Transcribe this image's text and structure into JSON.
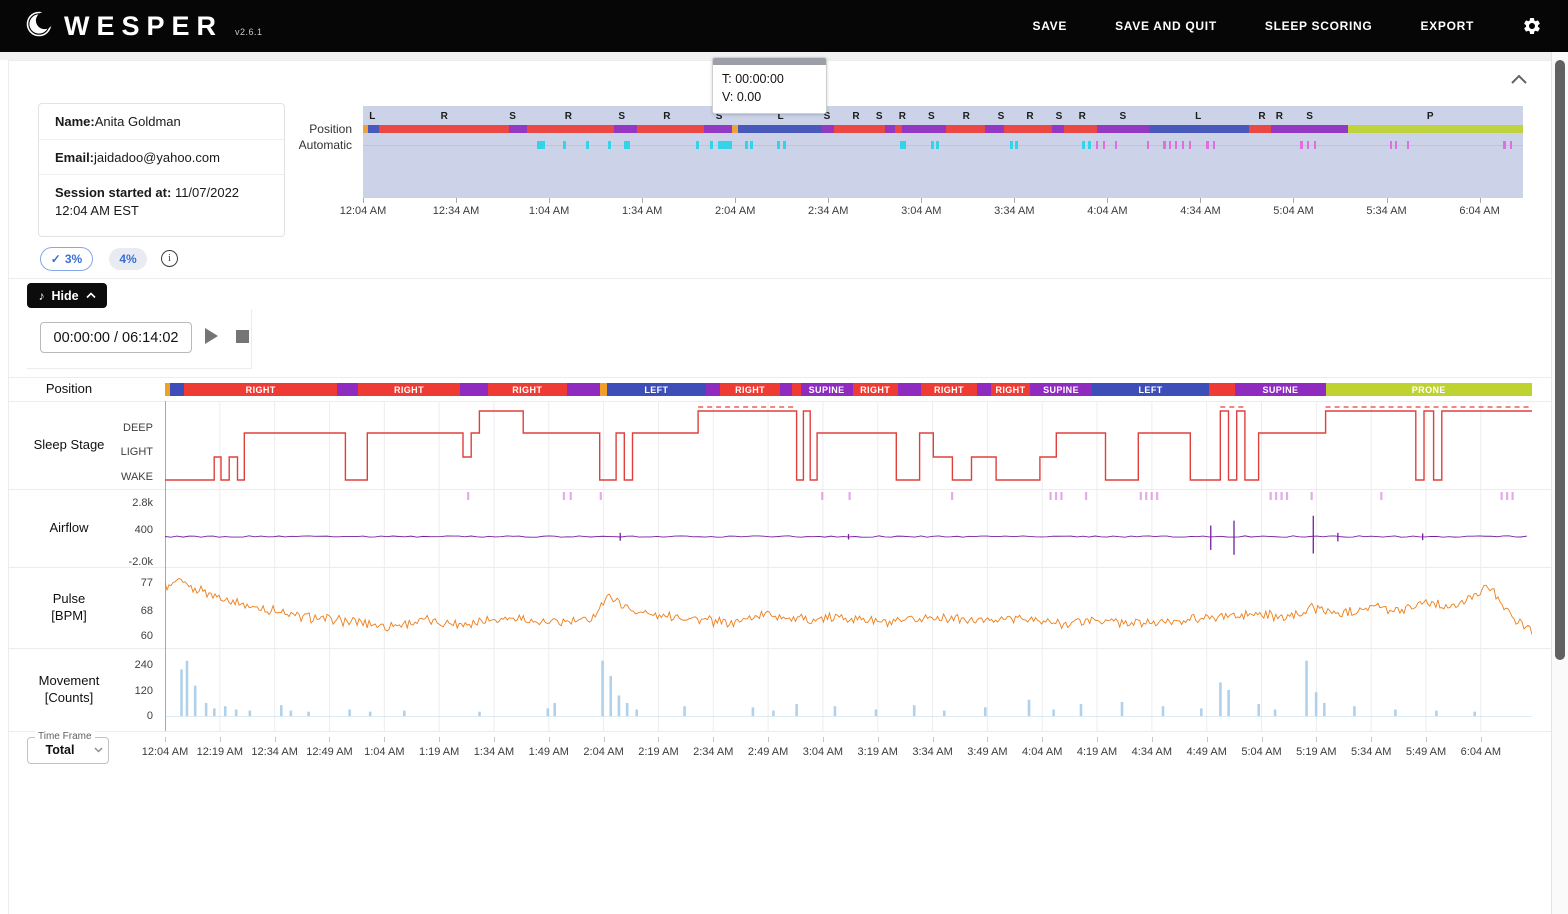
{
  "app": {
    "name": "WESPER",
    "version": "v2.6.1"
  },
  "navbar": {
    "items": [
      {
        "label": "SAVE"
      },
      {
        "label": "SAVE AND QUIT"
      },
      {
        "label": "SLEEP SCORING"
      },
      {
        "label": "EXPORT"
      }
    ],
    "settings_icon": "gear-icon"
  },
  "patient": {
    "name_label": "Name:",
    "name": "Anita Goldman",
    "email_label": "Email:",
    "email": "jaidadoo@yahoo.com",
    "session_label": "Session started at:",
    "session": " 11/07/2022 12:04 AM EST"
  },
  "tooltip": {
    "time_line": "T: 00:00:00",
    "value_line": "V: 0.00"
  },
  "overview_labels": {
    "position": "Position",
    "automatic": "Automatic"
  },
  "badges": {
    "primary": "3%",
    "primary_check": "✓",
    "secondary": "4%",
    "info_icon": "i"
  },
  "player": {
    "hide_label": "Hide",
    "note_icon": "♪",
    "time": "00:00:00 / 06:14:02"
  },
  "labels": {
    "position": "Position",
    "sleep_stage": "Sleep Stage",
    "airflow": "Airflow",
    "pulse": "Pulse\n[BPM]",
    "movement": "Movement\n[Counts]"
  },
  "timeframe": {
    "label": "Time Frame",
    "value": "Total"
  },
  "colors": {
    "red": "#ee3c35",
    "purple": "#8f2bbf",
    "blue": "#3d4eb8",
    "green": "#bed331",
    "orange": "#f0a028",
    "sleep": "#e0403c",
    "airflow": "#731fa0",
    "pulse": "#ee7d18",
    "movement": "#a9cce9",
    "cyan": "#35d3e8",
    "pink": "#e06ee0",
    "event": "#d98fe0",
    "overview_bg": "#ccd3e9",
    "accent_blue": "#3b6fd6"
  },
  "chart_data": {
    "duration_label": "06:14:02",
    "total_minutes": 374,
    "x_axis": {
      "step_minutes": 15,
      "ticks": [
        "12:04 AM",
        "12:19 AM",
        "12:34 AM",
        "12:49 AM",
        "1:04 AM",
        "1:19 AM",
        "1:34 AM",
        "1:49 AM",
        "2:04 AM",
        "2:19 AM",
        "2:34 AM",
        "2:49 AM",
        "3:04 AM",
        "3:19 AM",
        "3:34 AM",
        "3:49 AM",
        "4:04 AM",
        "4:19 AM",
        "4:34 AM",
        "4:49 AM",
        "5:04 AM",
        "5:19 AM",
        "5:34 AM",
        "5:49 AM",
        "6:04 AM"
      ]
    },
    "overview": {
      "type": "timeline",
      "step_minutes": 30,
      "ticks": [
        "12:04 AM",
        "12:34 AM",
        "1:04 AM",
        "1:34 AM",
        "2:04 AM",
        "2:34 AM",
        "3:04 AM",
        "3:34 AM",
        "4:04 AM",
        "4:34 AM",
        "5:04 AM",
        "5:34 AM",
        "6:04 AM"
      ],
      "letters": [
        [
          0.008,
          "L"
        ],
        [
          0.07,
          "R"
        ],
        [
          0.129,
          "S"
        ],
        [
          0.177,
          "R"
        ],
        [
          0.223,
          "S"
        ],
        [
          0.262,
          "R"
        ],
        [
          0.307,
          "S"
        ],
        [
          0.36,
          "L"
        ],
        [
          0.4,
          "S"
        ],
        [
          0.425,
          "R"
        ],
        [
          0.445,
          "S"
        ],
        [
          0.465,
          "R"
        ],
        [
          0.49,
          "S"
        ],
        [
          0.52,
          "R"
        ],
        [
          0.55,
          "S"
        ],
        [
          0.575,
          "R"
        ],
        [
          0.6,
          "S"
        ],
        [
          0.62,
          "R"
        ],
        [
          0.655,
          "S"
        ],
        [
          0.72,
          "L"
        ],
        [
          0.775,
          "R"
        ],
        [
          0.79,
          "R"
        ],
        [
          0.816,
          "S"
        ],
        [
          0.92,
          "P"
        ]
      ],
      "auto_marks": [
        [
          0.15,
          8,
          "cyan"
        ],
        [
          0.172,
          3,
          "cyan"
        ],
        [
          0.192,
          3,
          "cyan"
        ],
        [
          0.211,
          3,
          "cyan"
        ],
        [
          0.225,
          6,
          "cyan"
        ],
        [
          0.287,
          3,
          "cyan"
        ],
        [
          0.299,
          3,
          "cyan"
        ],
        [
          0.306,
          14,
          "cyan"
        ],
        [
          0.329,
          3,
          "cyan"
        ],
        [
          0.334,
          3,
          "cyan"
        ],
        [
          0.357,
          3,
          "cyan"
        ],
        [
          0.362,
          3,
          "cyan"
        ],
        [
          0.463,
          6,
          "cyan"
        ],
        [
          0.49,
          3,
          "cyan"
        ],
        [
          0.494,
          3,
          "cyan"
        ],
        [
          0.558,
          3,
          "cyan"
        ],
        [
          0.562,
          3,
          "cyan"
        ],
        [
          0.62,
          3,
          "cyan"
        ],
        [
          0.625,
          3,
          "cyan"
        ],
        [
          0.632,
          2,
          "pink"
        ],
        [
          0.638,
          2,
          "pink"
        ],
        [
          0.648,
          2,
          "pink"
        ],
        [
          0.676,
          2,
          "pink"
        ],
        [
          0.69,
          3,
          "pink"
        ],
        [
          0.695,
          2,
          "pink"
        ],
        [
          0.7,
          2,
          "pink"
        ],
        [
          0.706,
          2,
          "pink"
        ],
        [
          0.712,
          2,
          "pink"
        ],
        [
          0.727,
          3,
          "pink"
        ],
        [
          0.733,
          2,
          "pink"
        ],
        [
          0.808,
          3,
          "pink"
        ],
        [
          0.814,
          2,
          "pink"
        ],
        [
          0.82,
          2,
          "pink"
        ],
        [
          0.885,
          2,
          "pink"
        ],
        [
          0.89,
          2,
          "pink"
        ],
        [
          0.9,
          2,
          "pink"
        ],
        [
          0.983,
          3,
          "pink"
        ],
        [
          0.989,
          2,
          "pink"
        ]
      ]
    },
    "position": {
      "type": "timeline",
      "segments": [
        [
          0.0,
          0.004,
          "orange",
          ""
        ],
        [
          0.004,
          0.014,
          "blue",
          ""
        ],
        [
          0.014,
          0.126,
          "red",
          "RIGHT"
        ],
        [
          0.126,
          0.141,
          "purple",
          ""
        ],
        [
          0.141,
          0.216,
          "red",
          "RIGHT"
        ],
        [
          0.216,
          0.236,
          "purple",
          ""
        ],
        [
          0.236,
          0.294,
          "red",
          "RIGHT"
        ],
        [
          0.294,
          0.318,
          "purple",
          ""
        ],
        [
          0.318,
          0.323,
          "orange",
          ""
        ],
        [
          0.323,
          0.396,
          "blue",
          "LEFT"
        ],
        [
          0.396,
          0.406,
          "purple",
          ""
        ],
        [
          0.406,
          0.45,
          "red",
          "RIGHT"
        ],
        [
          0.45,
          0.459,
          "purple",
          ""
        ],
        [
          0.459,
          0.465,
          "red",
          ""
        ],
        [
          0.465,
          0.503,
          "purple",
          "SUPINE"
        ],
        [
          0.503,
          0.536,
          "red",
          "RIGHT"
        ],
        [
          0.536,
          0.553,
          "purple",
          ""
        ],
        [
          0.553,
          0.594,
          "red",
          "RIGHT"
        ],
        [
          0.594,
          0.604,
          "purple",
          ""
        ],
        [
          0.604,
          0.633,
          "red",
          "RIGHT"
        ],
        [
          0.633,
          0.678,
          "purple",
          "SUPINE"
        ],
        [
          0.678,
          0.764,
          "blue",
          "LEFT"
        ],
        [
          0.764,
          0.783,
          "red",
          ""
        ],
        [
          0.783,
          0.849,
          "purple",
          "SUPINE"
        ],
        [
          0.849,
          1.0,
          "green",
          "PRONE"
        ]
      ]
    },
    "sleep_stage": {
      "type": "step-line",
      "levels": [
        "DEEP",
        "LIGHT",
        "WAKE"
      ],
      "steps": [
        [
          0,
          "W"
        ],
        [
          0.036,
          "L"
        ],
        [
          0.041,
          "W"
        ],
        [
          0.047,
          "L"
        ],
        [
          0.053,
          "W"
        ],
        [
          0.058,
          "D"
        ],
        [
          0.132,
          "W"
        ],
        [
          0.148,
          "D"
        ],
        [
          0.218,
          "L"
        ],
        [
          0.224,
          "D"
        ],
        [
          0.23,
          "R"
        ],
        [
          0.262,
          "D"
        ],
        [
          0.318,
          "W"
        ],
        [
          0.33,
          "D"
        ],
        [
          0.336,
          "W"
        ],
        [
          0.342,
          "D"
        ],
        [
          0.39,
          "R"
        ],
        [
          0.462,
          "W"
        ],
        [
          0.467,
          "R"
        ],
        [
          0.472,
          "W"
        ],
        [
          0.477,
          "D"
        ],
        [
          0.535,
          "W"
        ],
        [
          0.552,
          "D"
        ],
        [
          0.562,
          "L"
        ],
        [
          0.576,
          "W"
        ],
        [
          0.59,
          "L"
        ],
        [
          0.608,
          "W"
        ],
        [
          0.64,
          "L"
        ],
        [
          0.652,
          "D"
        ],
        [
          0.688,
          "W"
        ],
        [
          0.712,
          "D"
        ],
        [
          0.75,
          "W"
        ],
        [
          0.772,
          "R"
        ],
        [
          0.778,
          "W"
        ],
        [
          0.784,
          "R"
        ],
        [
          0.79,
          "W"
        ],
        [
          0.8,
          "D"
        ],
        [
          0.849,
          "R"
        ],
        [
          0.915,
          "W"
        ],
        [
          0.921,
          "R"
        ],
        [
          0.928,
          "W"
        ],
        [
          0.934,
          "R"
        ]
      ],
      "rem_ranges": [
        [
          0.39,
          0.462
        ],
        [
          0.772,
          0.79
        ],
        [
          0.849,
          1.0
        ]
      ]
    },
    "airflow": {
      "type": "line",
      "yticks": [
        "2.8k",
        "400",
        "-2.0k"
      ],
      "baseline": 0,
      "spikes": [
        [
          0.333,
          300,
          350
        ],
        [
          0.5,
          200,
          250
        ],
        [
          0.765,
          900,
          1100
        ],
        [
          0.782,
          1300,
          1500
        ],
        [
          0.84,
          1700,
          1400
        ],
        [
          0.858,
          300,
          400
        ],
        [
          0.92,
          250,
          300
        ]
      ],
      "events": [
        0.221,
        0.291,
        0.296,
        0.318,
        0.48,
        0.5,
        0.575,
        0.647,
        0.651,
        0.655,
        0.673,
        0.713,
        0.717,
        0.721,
        0.725,
        0.808,
        0.812,
        0.816,
        0.82,
        0.838,
        0.889,
        0.977,
        0.981,
        0.985
      ]
    },
    "pulse": {
      "type": "line",
      "yticks": [
        "77",
        "68",
        "60"
      ],
      "ylim": [
        58,
        79
      ],
      "keypoints": [
        [
          0,
          76
        ],
        [
          0.01,
          77
        ],
        [
          0.03,
          74
        ],
        [
          0.05,
          71
        ],
        [
          0.07,
          69
        ],
        [
          0.1,
          66
        ],
        [
          0.13,
          65
        ],
        [
          0.16,
          63
        ],
        [
          0.19,
          65
        ],
        [
          0.22,
          64
        ],
        [
          0.25,
          66
        ],
        [
          0.28,
          64
        ],
        [
          0.31,
          65
        ],
        [
          0.325,
          73
        ],
        [
          0.335,
          70
        ],
        [
          0.35,
          67
        ],
        [
          0.38,
          66
        ],
        [
          0.41,
          64
        ],
        [
          0.44,
          67
        ],
        [
          0.47,
          65
        ],
        [
          0.5,
          66
        ],
        [
          0.53,
          64
        ],
        [
          0.56,
          66
        ],
        [
          0.59,
          65
        ],
        [
          0.62,
          66
        ],
        [
          0.65,
          64
        ],
        [
          0.68,
          65
        ],
        [
          0.71,
          64
        ],
        [
          0.74,
          65
        ],
        [
          0.77,
          66
        ],
        [
          0.8,
          67
        ],
        [
          0.82,
          66
        ],
        [
          0.84,
          69
        ],
        [
          0.86,
          67
        ],
        [
          0.88,
          70
        ],
        [
          0.9,
          68
        ],
        [
          0.92,
          71
        ],
        [
          0.94,
          69
        ],
        [
          0.955,
          72
        ],
        [
          0.965,
          76
        ],
        [
          0.975,
          73
        ],
        [
          0.985,
          66
        ],
        [
          1.0,
          62
        ]
      ]
    },
    "movement": {
      "type": "bar",
      "yticks": [
        "240",
        "120",
        "0"
      ],
      "ylim": [
        0,
        260
      ],
      "spikes": [
        [
          0.012,
          215
        ],
        [
          0.016,
          265
        ],
        [
          0.022,
          140
        ],
        [
          0.03,
          60
        ],
        [
          0.036,
          35
        ],
        [
          0.044,
          45
        ],
        [
          0.052,
          30
        ],
        [
          0.062,
          25
        ],
        [
          0.085,
          50
        ],
        [
          0.092,
          25
        ],
        [
          0.105,
          20
        ],
        [
          0.135,
          30
        ],
        [
          0.15,
          20
        ],
        [
          0.175,
          25
        ],
        [
          0.23,
          20
        ],
        [
          0.28,
          35
        ],
        [
          0.285,
          60
        ],
        [
          0.32,
          255
        ],
        [
          0.326,
          185
        ],
        [
          0.332,
          95
        ],
        [
          0.338,
          60
        ],
        [
          0.345,
          30
        ],
        [
          0.38,
          45
        ],
        [
          0.43,
          40
        ],
        [
          0.445,
          25
        ],
        [
          0.462,
          55
        ],
        [
          0.49,
          45
        ],
        [
          0.52,
          30
        ],
        [
          0.548,
          50
        ],
        [
          0.57,
          25
        ],
        [
          0.6,
          40
        ],
        [
          0.632,
          75
        ],
        [
          0.65,
          30
        ],
        [
          0.67,
          55
        ],
        [
          0.7,
          65
        ],
        [
          0.73,
          45
        ],
        [
          0.758,
          35
        ],
        [
          0.772,
          155
        ],
        [
          0.778,
          120
        ],
        [
          0.8,
          55
        ],
        [
          0.812,
          30
        ],
        [
          0.835,
          255
        ],
        [
          0.842,
          110
        ],
        [
          0.848,
          60
        ],
        [
          0.87,
          45
        ],
        [
          0.9,
          30
        ],
        [
          0.93,
          25
        ],
        [
          0.958,
          20
        ]
      ]
    }
  }
}
